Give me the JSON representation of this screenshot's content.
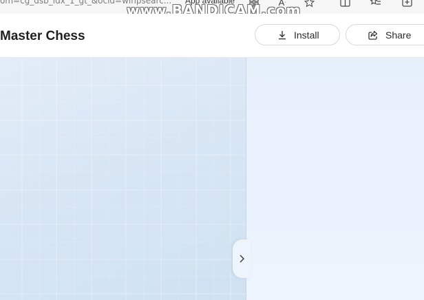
{
  "browser": {
    "url_text": "om=cg_dsb_idx_1_gt_&ocid=winpsearc...",
    "app_available": "App available",
    "watermark": "www.BANDICAM.com",
    "icons": [
      "app-grid-icon",
      "read-aloud-icon",
      "favorite-star-icon",
      "split-screen-icon",
      "favorites-list-icon",
      "collections-icon"
    ]
  },
  "header": {
    "title": "Master Chess",
    "install_label": "Install",
    "share_label": "Share"
  },
  "colors": {
    "left_panel": "#d8e6f4",
    "right_panel": "#e9f1fc",
    "header_bg": "#ffffff"
  }
}
